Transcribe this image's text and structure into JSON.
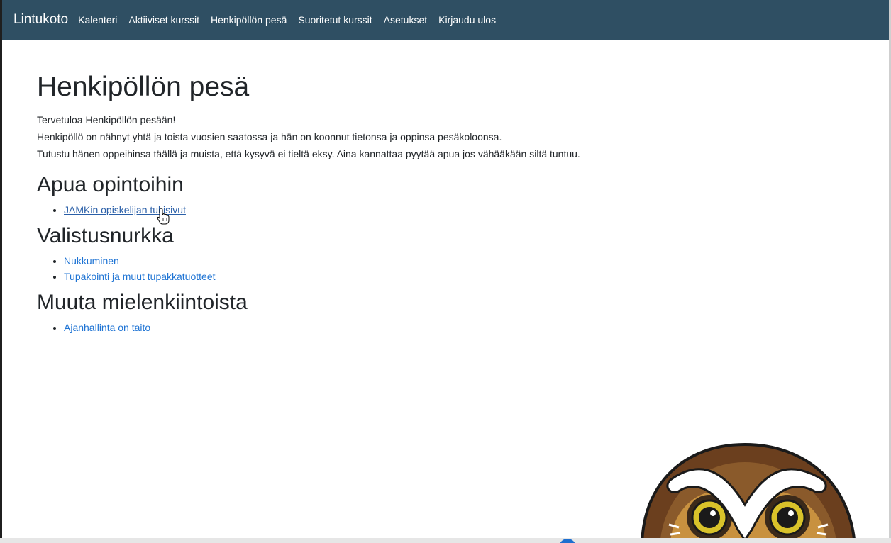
{
  "nav": {
    "brand": "Lintukoto",
    "links": [
      "Kalenteri",
      "Aktiiviset kurssit",
      "Henkipöllön pesä",
      "Suoritetut kurssit",
      "Asetukset",
      "Kirjaudu ulos"
    ]
  },
  "page": {
    "title": "Henkipöllön pesä",
    "intro": [
      "Tervetuloa Henkipöllön pesään!",
      "Henkipöllö on nähnyt yhtä ja toista vuosien saatossa ja hän on koonnut tietonsa ja oppinsa pesäkoloonsa.",
      "Tutustu hänen oppeihinsa täällä ja muista, että kysyvä ei tieltä eksy. Aina kannattaa pyytää apua jos vähääkään siltä tuntuu."
    ]
  },
  "sections": [
    {
      "heading": "Apua opintoihin",
      "links": [
        "JAMKin opiskelijan tukisivut"
      ]
    },
    {
      "heading": "Valistusnurkka",
      "links": [
        "Nukkuminen",
        "Tupakointi ja muut tupakkatuotteet"
      ]
    },
    {
      "heading": "Muuta mielenkiintoista",
      "links": [
        "Ajanhallinta on taito"
      ]
    }
  ],
  "icons": {
    "cursor": "hand-pointer-cursor-icon",
    "mascot": "owl-mascot-icon"
  },
  "colors": {
    "navbar": "#2f4f63",
    "link": "#1f74d4",
    "text": "#212529"
  }
}
